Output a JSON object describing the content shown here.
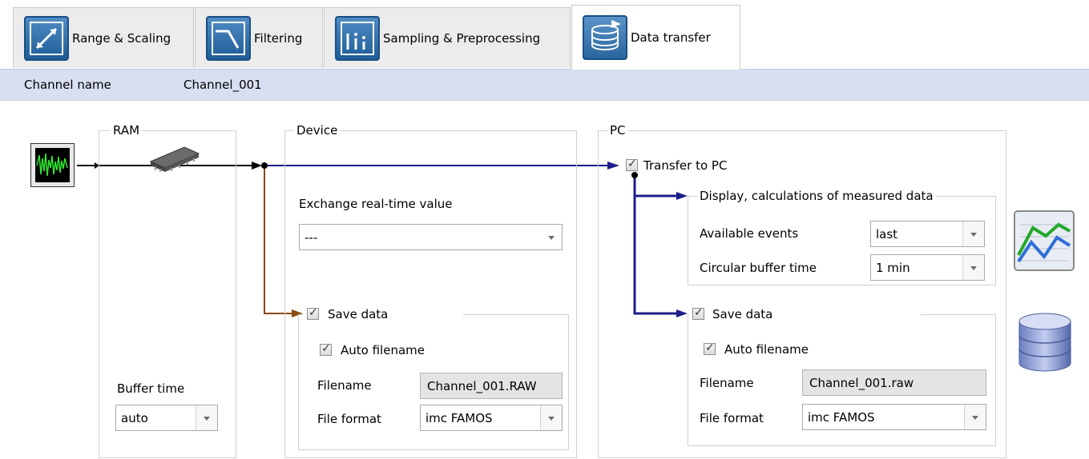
{
  "tabs": [
    {
      "label": "Range & Scaling",
      "icon": "range-scaling-icon"
    },
    {
      "label": "Filtering",
      "icon": "filtering-icon"
    },
    {
      "label": "Sampling & Preprocessing",
      "icon": "sampling-icon"
    },
    {
      "label": "Data transfer",
      "icon": "data-transfer-icon"
    }
  ],
  "channel": {
    "name_label": "Channel name",
    "name_value": "Channel_001"
  },
  "ram": {
    "title": "RAM",
    "buffer_time_label": "Buffer time",
    "buffer_time_value": "auto"
  },
  "device": {
    "title": "Device",
    "exchange_label": "Exchange real-time value",
    "exchange_value": "---",
    "save_data_label": "Save data",
    "save_data_checked": true,
    "auto_filename_label": "Auto filename",
    "auto_filename_checked": true,
    "filename_label": "Filename",
    "filename_value": "Channel_001.RAW",
    "file_format_label": "File format",
    "file_format_value": "imc FAMOS"
  },
  "pc": {
    "title": "PC",
    "transfer_label": "Transfer to PC",
    "transfer_checked": true,
    "display_group_title": "Display, calculations of measured data",
    "available_events_label": "Available events",
    "available_events_value": "last",
    "circular_buffer_label": "Circular buffer time",
    "circular_buffer_value": "1 min",
    "save_data_label": "Save data",
    "save_data_checked": true,
    "auto_filename_label": "Auto filename",
    "auto_filename_checked": true,
    "filename_label": "Filename",
    "filename_value": "Channel_001.raw",
    "file_format_label": "File format",
    "file_format_value": "imc FAMOS"
  },
  "colors": {
    "device_path": "#8b4a0f",
    "pc_path": "#1c1c8a",
    "band": "#d7dff0"
  }
}
